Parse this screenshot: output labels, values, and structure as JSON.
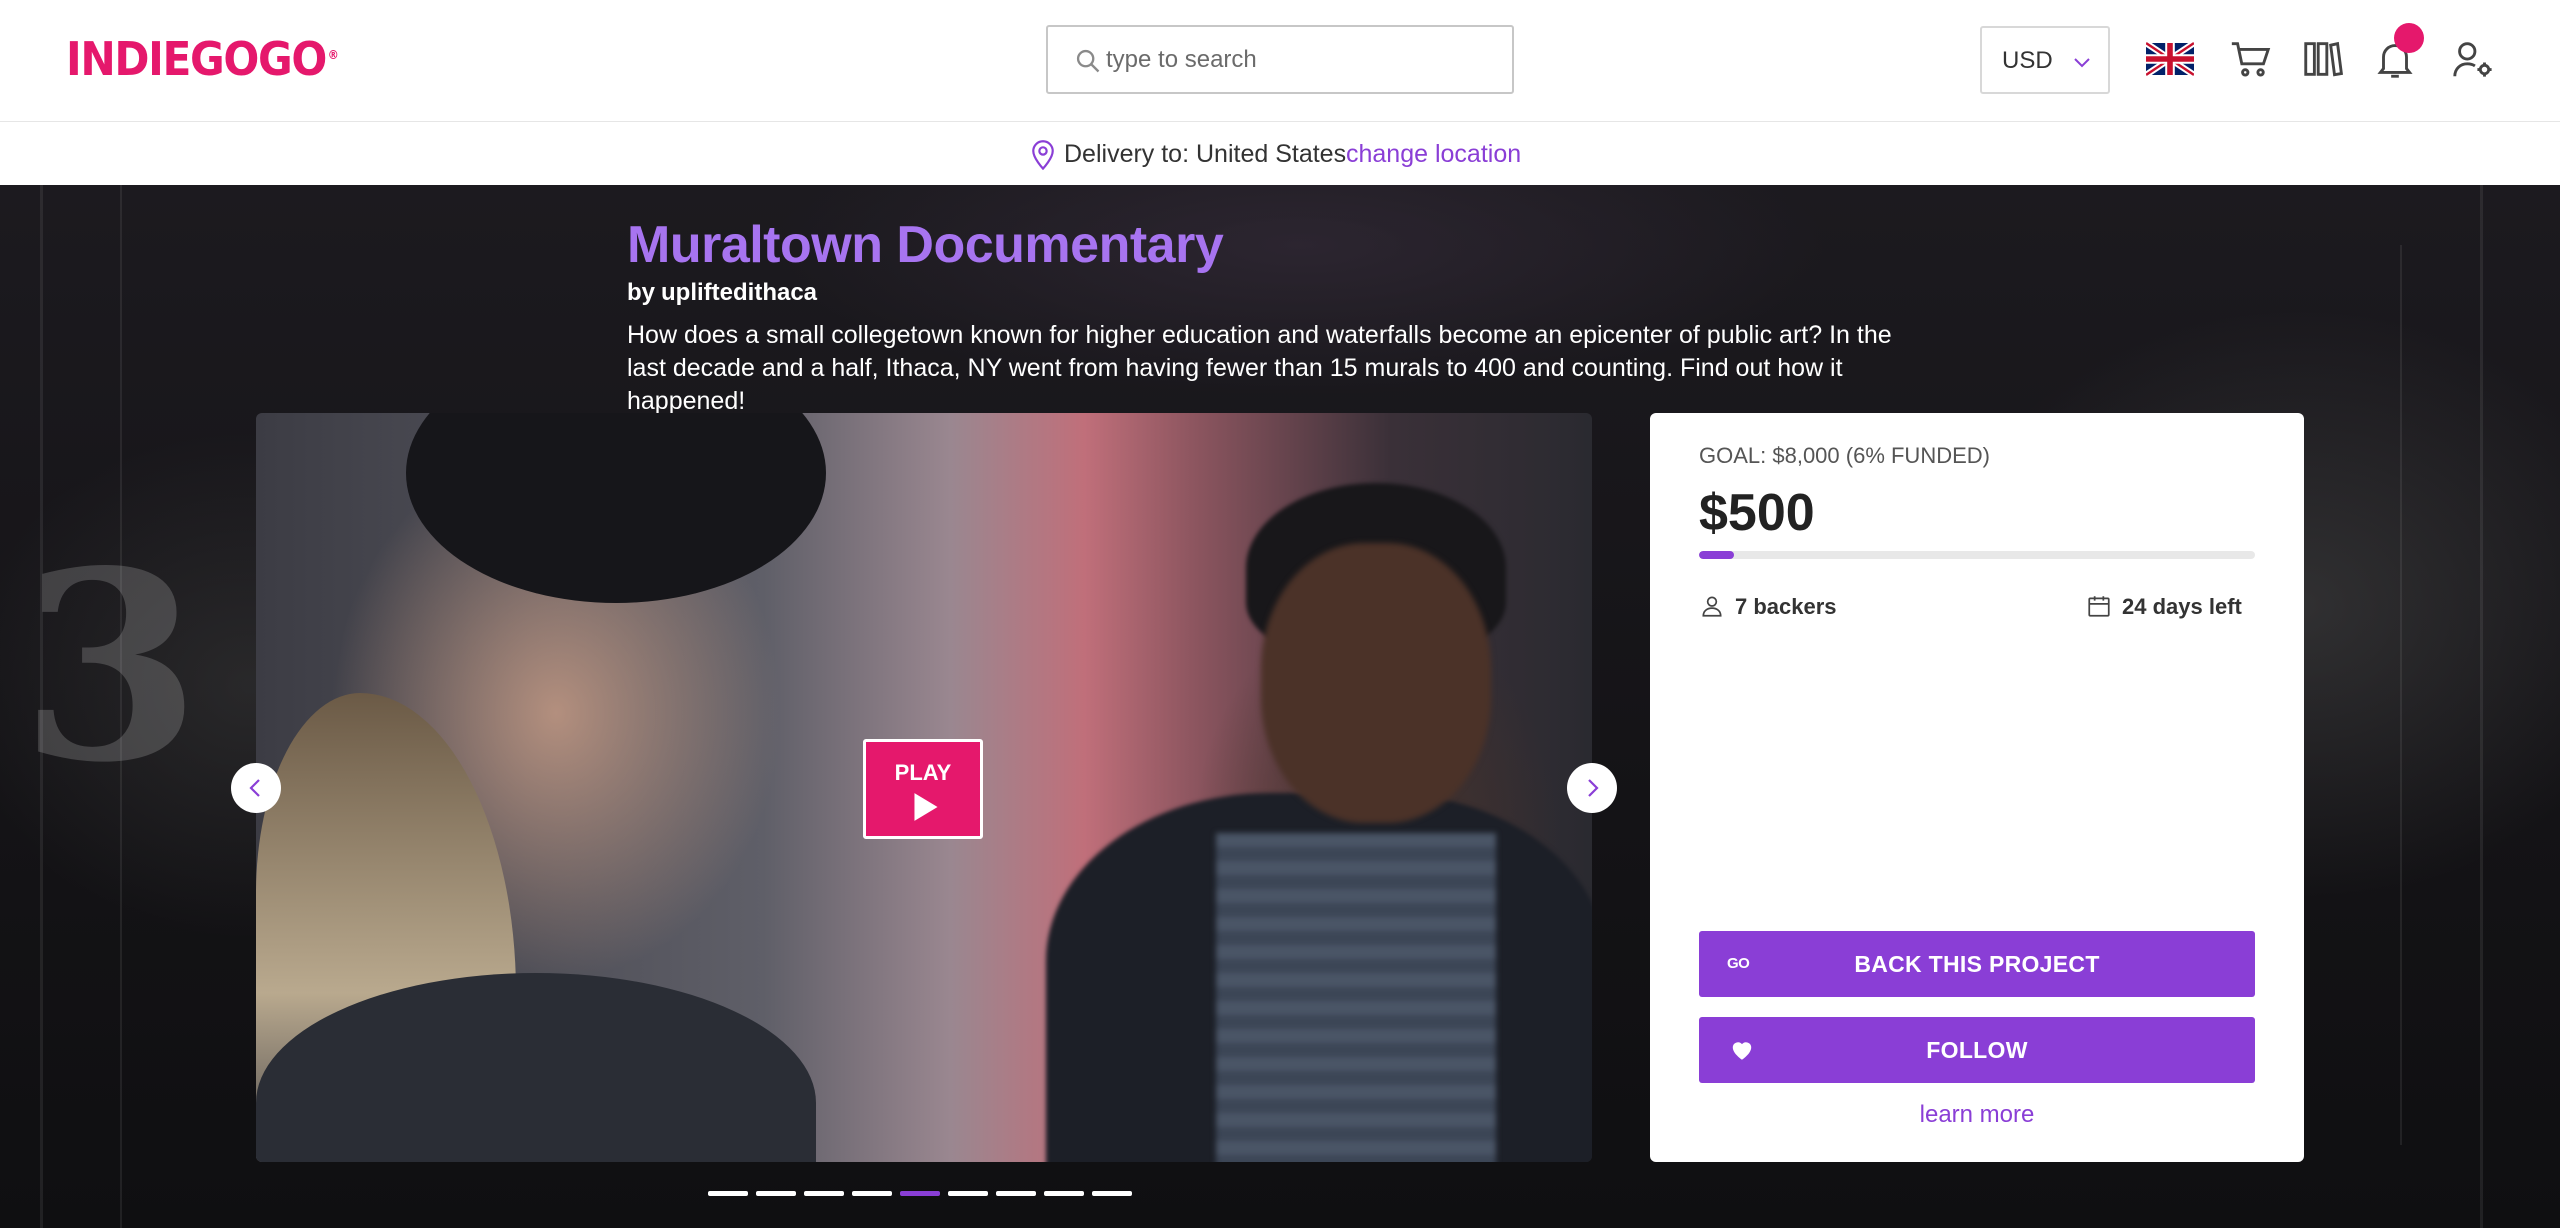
{
  "header": {
    "logo": "INDIEGOGO",
    "logo_mark": "®",
    "search": {
      "placeholder": "type to search",
      "icon": "search-icon"
    },
    "currency": {
      "selected": "USD"
    },
    "icons": [
      "uk-flag-icon",
      "cart-icon",
      "library-icon",
      "bell-icon",
      "user-settings-icon"
    ],
    "colors": {
      "brand": "#e5186c",
      "accent": "#8a3ed6"
    }
  },
  "delivery": {
    "label": "Delivery to: United States",
    "change_link": "change location"
  },
  "campaign": {
    "title": "Muraltown Documentary",
    "byline_prefix": "by",
    "author": "upliftedithaca",
    "description": "How does a small collegetown known for higher education and waterfalls become an epicenter of public art? In the last decade and a half, Ithaca, NY went from having fewer than 15 murals to 400 and counting. Find out how it happened!"
  },
  "media": {
    "play_label": "PLAY",
    "slide_count": 9,
    "active_slide": 5
  },
  "funding": {
    "goal_text": "GOAL: $8,000 (6% FUNDED)",
    "raised": "$500",
    "funded_fraction": 0.0625,
    "backers": "7 backers",
    "days_left": "24 days left",
    "back_button": "BACK THIS PROJECT",
    "back_icon_text": "GO",
    "follow_button": "FOLLOW",
    "learn_more": "learn more"
  }
}
